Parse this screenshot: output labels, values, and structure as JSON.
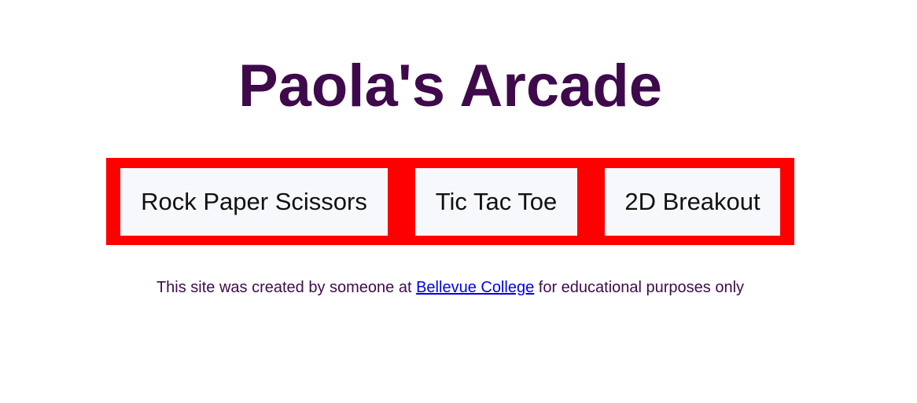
{
  "header": {
    "title": "Paola's Arcade"
  },
  "nav": {
    "buttons": [
      {
        "label": "Rock Paper Scissors"
      },
      {
        "label": "Tic Tac Toe"
      },
      {
        "label": "2D Breakout"
      }
    ]
  },
  "footer": {
    "text_before": "This site was created by someone at ",
    "link_text": "Bellevue College",
    "text_after": " for educational purposes only"
  },
  "colors": {
    "title": "#3f0a4b",
    "nav_background": "#ff0000",
    "button_background": "#f7f8fc",
    "link": "#0000ee"
  }
}
